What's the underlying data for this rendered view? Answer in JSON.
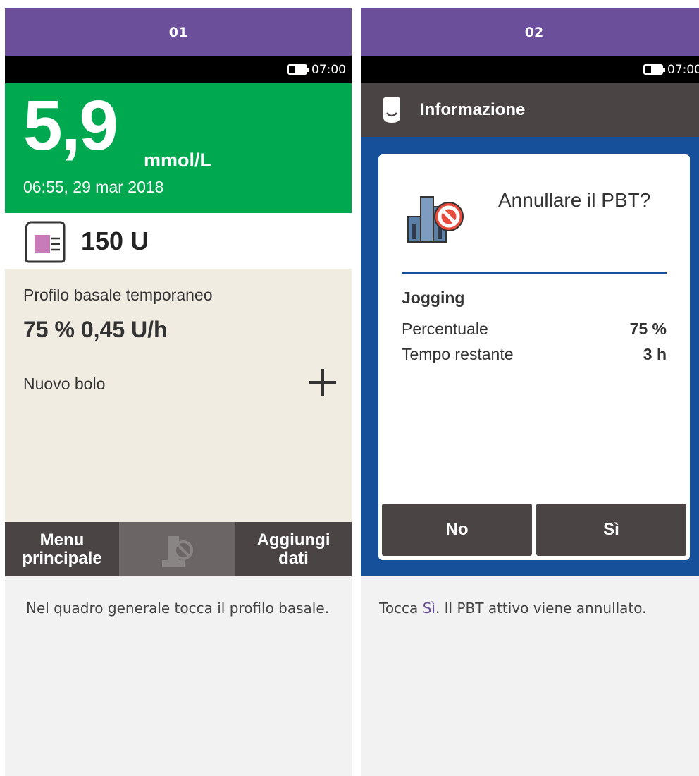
{
  "panel1": {
    "step": "01",
    "status": {
      "time": "07:00"
    },
    "glucose": {
      "value": "5,9",
      "unit": "mmol/L",
      "timestamp": "06:55, 29 mar 2018"
    },
    "cartridge": {
      "amount": "150 U"
    },
    "basal": {
      "label": "Profilo basale temporaneo",
      "value": "75 % 0,45 U/h"
    },
    "bolus": {
      "label": "Nuovo bolo"
    },
    "nav": {
      "left": "Menu\nprincipale",
      "right": "Aggiungi\ndati"
    },
    "caption": "Nel quadro generale tocca il profilo basale."
  },
  "panel2": {
    "step": "02",
    "status": {
      "time": "07:00"
    },
    "info_title": "Informazione",
    "dialog": {
      "title": "Annullare il PBT?",
      "preset": "Jogging",
      "rows": [
        {
          "label": "Percentuale",
          "value": "75 %"
        },
        {
          "label": "Tempo restante",
          "value": "3 h"
        }
      ],
      "no": "No",
      "yes": "Sì"
    },
    "caption": {
      "before": "Tocca ",
      "highlight": "Sì",
      "after": ". Il PBT attivo viene annullato."
    }
  },
  "colors": {
    "header": "#6b4f9a",
    "glucose_ok": "#00a94f",
    "dialog_bg": "#17509a",
    "dark_button": "#4a4444",
    "basal_bg": "#f1ece2"
  },
  "icons": [
    "battery-icon",
    "cartridge-icon",
    "plus-icon",
    "tbr-cancel-icon",
    "pump-icon",
    "cancel-tbr-chart-icon"
  ]
}
